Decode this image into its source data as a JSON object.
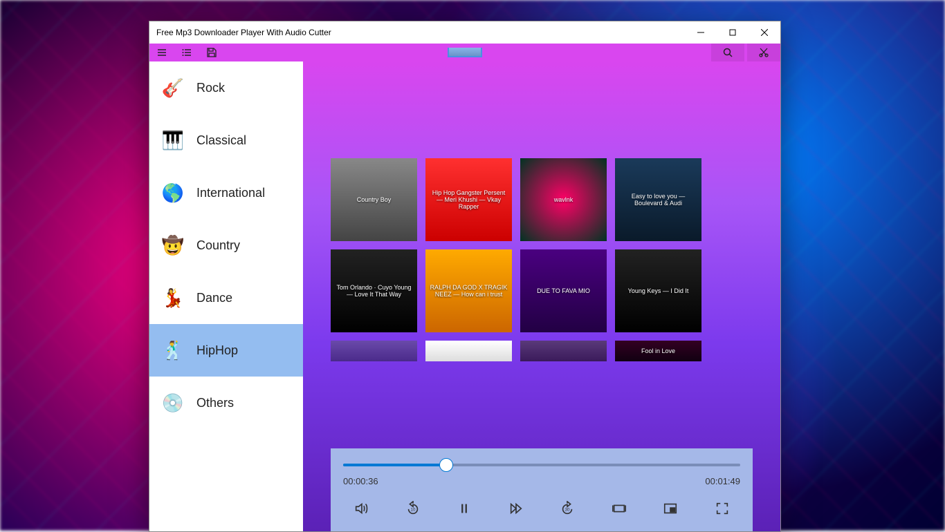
{
  "window": {
    "title": "Free Mp3 Downloader Player With Audio Cutter"
  },
  "toolbar": {
    "menu": "menu",
    "list": "list",
    "save": "save",
    "search": "search",
    "cut": "cut"
  },
  "sidebar": {
    "items": [
      {
        "label": "Rock",
        "icon": "🎸",
        "selected": false
      },
      {
        "label": "Classical",
        "icon": "🎹",
        "selected": false
      },
      {
        "label": "International",
        "icon": "🌎",
        "selected": false
      },
      {
        "label": "Country",
        "icon": "🤠",
        "selected": false
      },
      {
        "label": "Dance",
        "icon": "💃",
        "selected": false
      },
      {
        "label": "HipHop",
        "icon": "🕺",
        "selected": true
      },
      {
        "label": "Others",
        "icon": "💿",
        "selected": false
      }
    ]
  },
  "albums": [
    {
      "title": "Country Boy",
      "bg": "linear-gradient(#888,#444)"
    },
    {
      "title": "Hip Hop Gangster Persent — Meri Khushi — Vkay Rapper",
      "bg": "linear-gradient(#ff3030,#cc0000)"
    },
    {
      "title": "wavlnk",
      "bg": "radial-gradient(circle,#ff0066,#003322)"
    },
    {
      "title": "Easy to love you — Boulevard & Audi",
      "bg": "linear-gradient(#1a3a5a,#0a1a2a)"
    },
    {
      "title": "Tom Orlando · Cuyo Young — Love It That Way",
      "bg": "linear-gradient(#222,#000)"
    },
    {
      "title": "RALPH DA GOD X TRAGIK NEEZ — How can i trust",
      "bg": "linear-gradient(#ffaa00,#cc6600)"
    },
    {
      "title": "DUE TO FAVA MIO",
      "bg": "linear-gradient(#4a0080,#220044)"
    },
    {
      "title": "Young Keys — I Did It",
      "bg": "linear-gradient(#222,#000)"
    },
    {
      "title": "",
      "bg": "linear-gradient(#6a4aaa,#4a2a8a)"
    },
    {
      "title": "",
      "bg": "linear-gradient(#fff,#ddd)"
    },
    {
      "title": "",
      "bg": "linear-gradient(#5a3a7a,#3a1a5a)"
    },
    {
      "title": "Fool in Love",
      "bg": "linear-gradient(#330022,#110011)"
    }
  ],
  "player": {
    "current_time": "00:00:36",
    "total_time": "00:01:49",
    "progress_percent": 26
  }
}
